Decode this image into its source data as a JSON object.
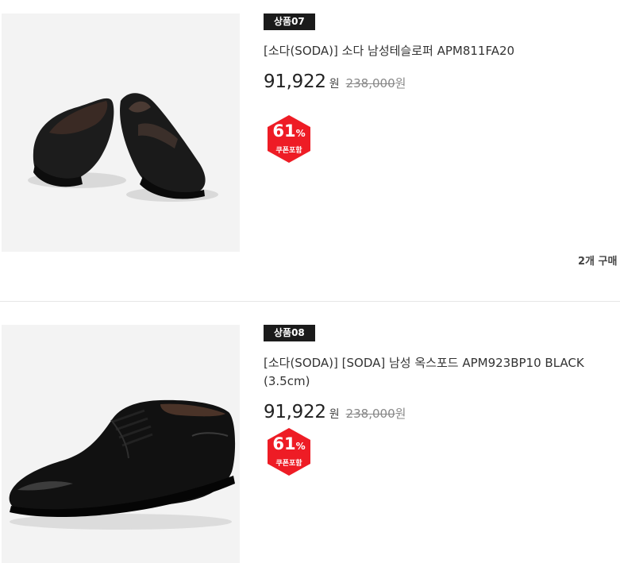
{
  "products": [
    {
      "badge": "상품07",
      "name": "[소다(SODA)] 소다 남성테슬로퍼 APM811FA20",
      "price": "91,922",
      "currency": "원",
      "original_price": "238,000",
      "original_currency": "원",
      "discount": "61",
      "discount_unit": "%",
      "coupon_label": "쿠폰포함",
      "buy_count": "2개 구매"
    },
    {
      "badge": "상품08",
      "name": "[소다(SODA)] [SODA] 남성 옥스포드 APM923BP10 BLACK (3.5cm)",
      "price": "91,922",
      "currency": "원",
      "original_price": "238,000",
      "original_currency": "원",
      "discount": "61",
      "discount_unit": "%",
      "coupon_label": "쿠폰포함"
    }
  ],
  "colors": {
    "sale_red": "#ee1c25",
    "badge_black": "#1b1b1b",
    "thumb_bg": "#f3f3f3"
  }
}
